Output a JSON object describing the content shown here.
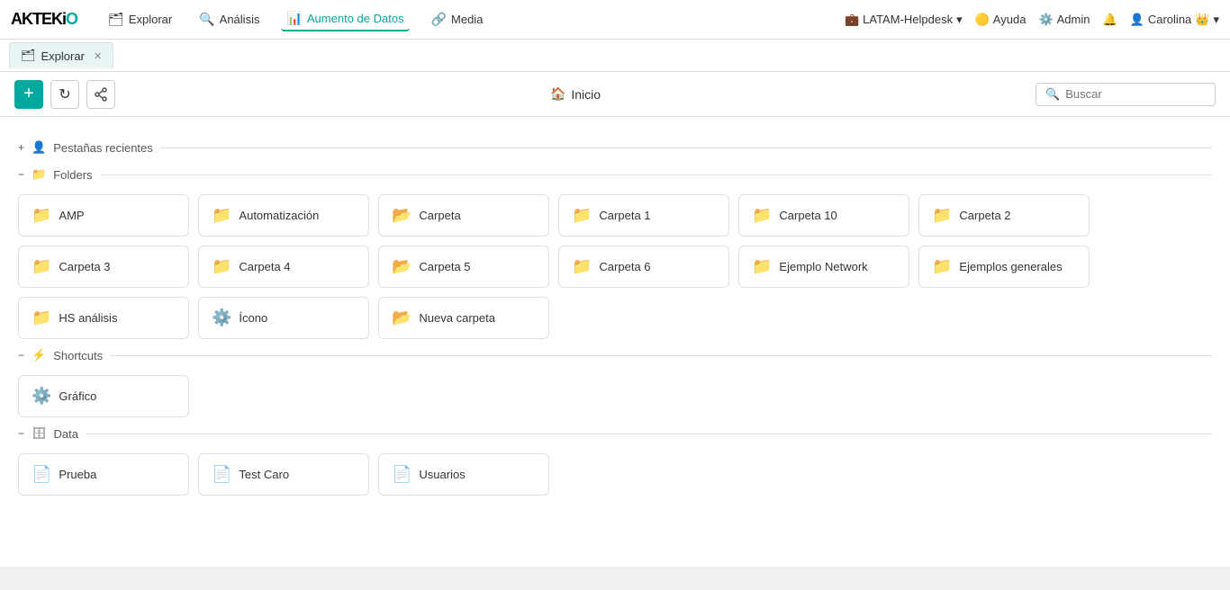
{
  "logo": {
    "text_black": "AKTEKI",
    "text_teal": "O"
  },
  "nav": {
    "items": [
      {
        "id": "explorar",
        "label": "Explorar",
        "icon": "🗂",
        "active": false
      },
      {
        "id": "analisis",
        "label": "Análisis",
        "icon": "🔍",
        "active": false
      },
      {
        "id": "aumento",
        "label": "Aumento de Datos",
        "icon": "📊",
        "active": true
      },
      {
        "id": "media",
        "label": "Media",
        "icon": "🔗",
        "active": false
      }
    ],
    "right": {
      "helpdesk_label": "LATAM-Helpdesk",
      "help_label": "Ayuda",
      "admin_label": "Admin",
      "user_label": "Carolina"
    }
  },
  "tabs": [
    {
      "id": "explorar-tab",
      "label": "Explorar",
      "closable": true
    }
  ],
  "toolbar": {
    "add_label": "+",
    "refresh_label": "↻",
    "share_label": "⚙",
    "home_label": "Inicio",
    "search_placeholder": "Buscar"
  },
  "sections": {
    "recent": {
      "label": "Pestañas recientes",
      "collapsed": false
    },
    "folders": {
      "label": "Folders",
      "collapsed": false,
      "items": [
        {
          "id": "amp",
          "label": "AMP",
          "icon_color": "icon-dark-teal",
          "icon": "folder"
        },
        {
          "id": "automatizacion",
          "label": "Automatización",
          "icon_color": "icon-dark-teal",
          "icon": "folder"
        },
        {
          "id": "carpeta",
          "label": "Carpeta",
          "icon_color": "icon-light-teal",
          "icon": "folder-outline"
        },
        {
          "id": "carpeta1",
          "label": "Carpeta 1",
          "icon_color": "icon-blue",
          "icon": "folder"
        },
        {
          "id": "carpeta10",
          "label": "Carpeta 10",
          "icon_color": "icon-teal",
          "icon": "folder"
        },
        {
          "id": "carpeta2",
          "label": "Carpeta 2",
          "icon_color": "icon-dark-teal",
          "icon": "folder"
        },
        {
          "id": "carpeta3",
          "label": "Carpeta 3",
          "icon_color": "icon-dark-teal",
          "icon": "folder"
        },
        {
          "id": "carpeta4",
          "label": "Carpeta 4",
          "icon_color": "icon-dark-teal",
          "icon": "folder"
        },
        {
          "id": "carpeta5",
          "label": "Carpeta 5",
          "icon_color": "icon-light-teal",
          "icon": "folder-outline"
        },
        {
          "id": "carpeta6",
          "label": "Carpeta 6",
          "icon_color": "icon-blue",
          "icon": "folder"
        },
        {
          "id": "ejemplo-network",
          "label": "Ejemplo Network",
          "icon_color": "icon-teal",
          "icon": "folder"
        },
        {
          "id": "ejemplos-generales",
          "label": "Ejemplos generales",
          "icon_color": "icon-dark-teal",
          "icon": "folder"
        },
        {
          "id": "hs-analisis",
          "label": "HS análisis",
          "icon_color": "icon-dark-teal",
          "icon": "folder"
        },
        {
          "id": "icono",
          "label": "Ícono",
          "icon_color": "icon-orange",
          "icon": "special"
        },
        {
          "id": "nueva-carpeta",
          "label": "Nueva carpeta",
          "icon_color": "icon-red",
          "icon": "folder-outline"
        }
      ]
    },
    "shortcuts": {
      "label": "Shortcuts",
      "collapsed": false,
      "items": [
        {
          "id": "grafico",
          "label": "Gráfico",
          "icon_color": "icon-gear",
          "icon": "gear"
        }
      ]
    },
    "data": {
      "label": "Data",
      "collapsed": false,
      "items": [
        {
          "id": "prueba",
          "label": "Prueba",
          "icon_color": "icon-yellow",
          "icon": "data"
        },
        {
          "id": "test-caro",
          "label": "Test Caro",
          "icon_color": "icon-yellow",
          "icon": "data"
        },
        {
          "id": "usuarios",
          "label": "Usuarios",
          "icon_color": "icon-yellow",
          "icon": "data"
        }
      ]
    }
  }
}
